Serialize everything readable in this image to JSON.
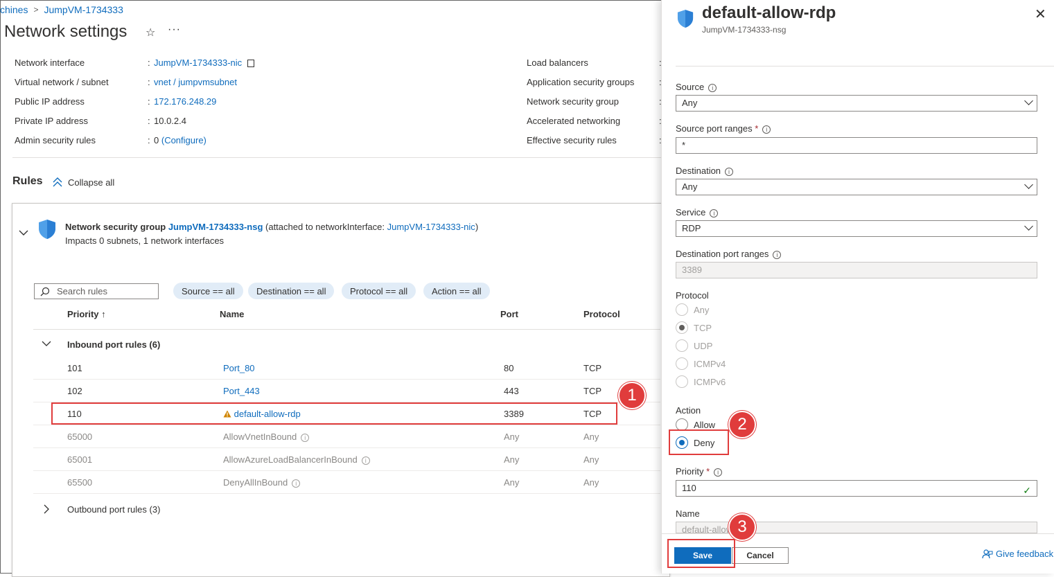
{
  "breadcrumb": {
    "part1": "chines",
    "part2": "JumpVM-1734333",
    "separator": ">"
  },
  "page": {
    "title": "Network settings",
    "star": "☆",
    "more": "···"
  },
  "essentials": {
    "left": [
      {
        "label": "Network interface",
        "value": "JumpVM-1734333-nic",
        "link": true
      },
      {
        "label": "Virtual network / subnet",
        "value": "vnet / jumpvmsubnet",
        "link": true
      },
      {
        "label": "Public IP address",
        "value": "172.176.248.29",
        "link": true
      },
      {
        "label": "Private IP address",
        "value": "10.0.2.4",
        "link": false
      },
      {
        "label": "Admin security rules",
        "value": "0",
        "value_link": "(Configure)"
      }
    ],
    "right": [
      {
        "label": "Load balancers"
      },
      {
        "label": "Application security groups"
      },
      {
        "label": "Network security group"
      },
      {
        "label": "Accelerated networking"
      },
      {
        "label": "Effective security rules"
      }
    ]
  },
  "rules": {
    "heading": "Rules",
    "collapse_label": "Collapse all"
  },
  "nsg": {
    "prefix": "Network security group",
    "name": "JumpVM-1734333-nsg",
    "attached_prefix": "(attached to networkInterface:",
    "attached_nic": "JumpVM-1734333-nic",
    "attached_suffix": ")",
    "impacts": "Impacts 0 subnets, 1 network interfaces"
  },
  "filters": {
    "search_placeholder": "Search rules",
    "pills": [
      "Source == all",
      "Destination == all",
      "Protocol == all",
      "Action == all"
    ]
  },
  "table": {
    "headers": {
      "priority": "Priority ↑",
      "name": "Name",
      "port": "Port",
      "protocol": "Protocol"
    },
    "inbound_group": "Inbound port rules (6)",
    "outbound_group": "Outbound port rules (3)",
    "rows": [
      {
        "priority": "101",
        "name": "Port_80",
        "port": "80",
        "protocol": "TCP"
      },
      {
        "priority": "102",
        "name": "Port_443",
        "port": "443",
        "protocol": "TCP"
      },
      {
        "priority": "110",
        "name": "default-allow-rdp",
        "port": "3389",
        "protocol": "TCP"
      },
      {
        "priority": "65000",
        "name": "AllowVnetInBound",
        "port": "Any",
        "protocol": "Any"
      },
      {
        "priority": "65001",
        "name": "AllowAzureLoadBalancerInBound",
        "port": "Any",
        "protocol": "Any"
      },
      {
        "priority": "65500",
        "name": "DenyAllInBound",
        "port": "Any",
        "protocol": "Any"
      }
    ]
  },
  "annotations": {
    "one": "1",
    "two": "2",
    "three": "3",
    "color": "#e03c3c"
  },
  "panel": {
    "title": "default-allow-rdp",
    "subtitle": "JumpVM-1734333-nsg",
    "close": "✕",
    "source": {
      "label": "Source",
      "value": "Any"
    },
    "source_ports": {
      "label": "Source port ranges",
      "value": "*"
    },
    "destination": {
      "label": "Destination",
      "value": "Any"
    },
    "service": {
      "label": "Service",
      "value": "RDP"
    },
    "dest_ports": {
      "label": "Destination port ranges",
      "value": "3389"
    },
    "protocol": {
      "label": "Protocol",
      "options": [
        "Any",
        "TCP",
        "UDP",
        "ICMPv4",
        "ICMPv6"
      ],
      "selected": "TCP"
    },
    "action": {
      "label": "Action",
      "options": [
        "Allow",
        "Deny"
      ],
      "selected": "Deny"
    },
    "priority": {
      "label": "Priority",
      "value": "110"
    },
    "name": {
      "label": "Name",
      "value": "default-allow"
    },
    "save": "Save",
    "cancel": "Cancel",
    "feedback": "Give feedback",
    "required_mark": "*"
  },
  "colors": {
    "link": "#0f6cbd",
    "primary": "#0f6cbd",
    "annotation": "#e03c3c",
    "warning": "#d08400"
  }
}
